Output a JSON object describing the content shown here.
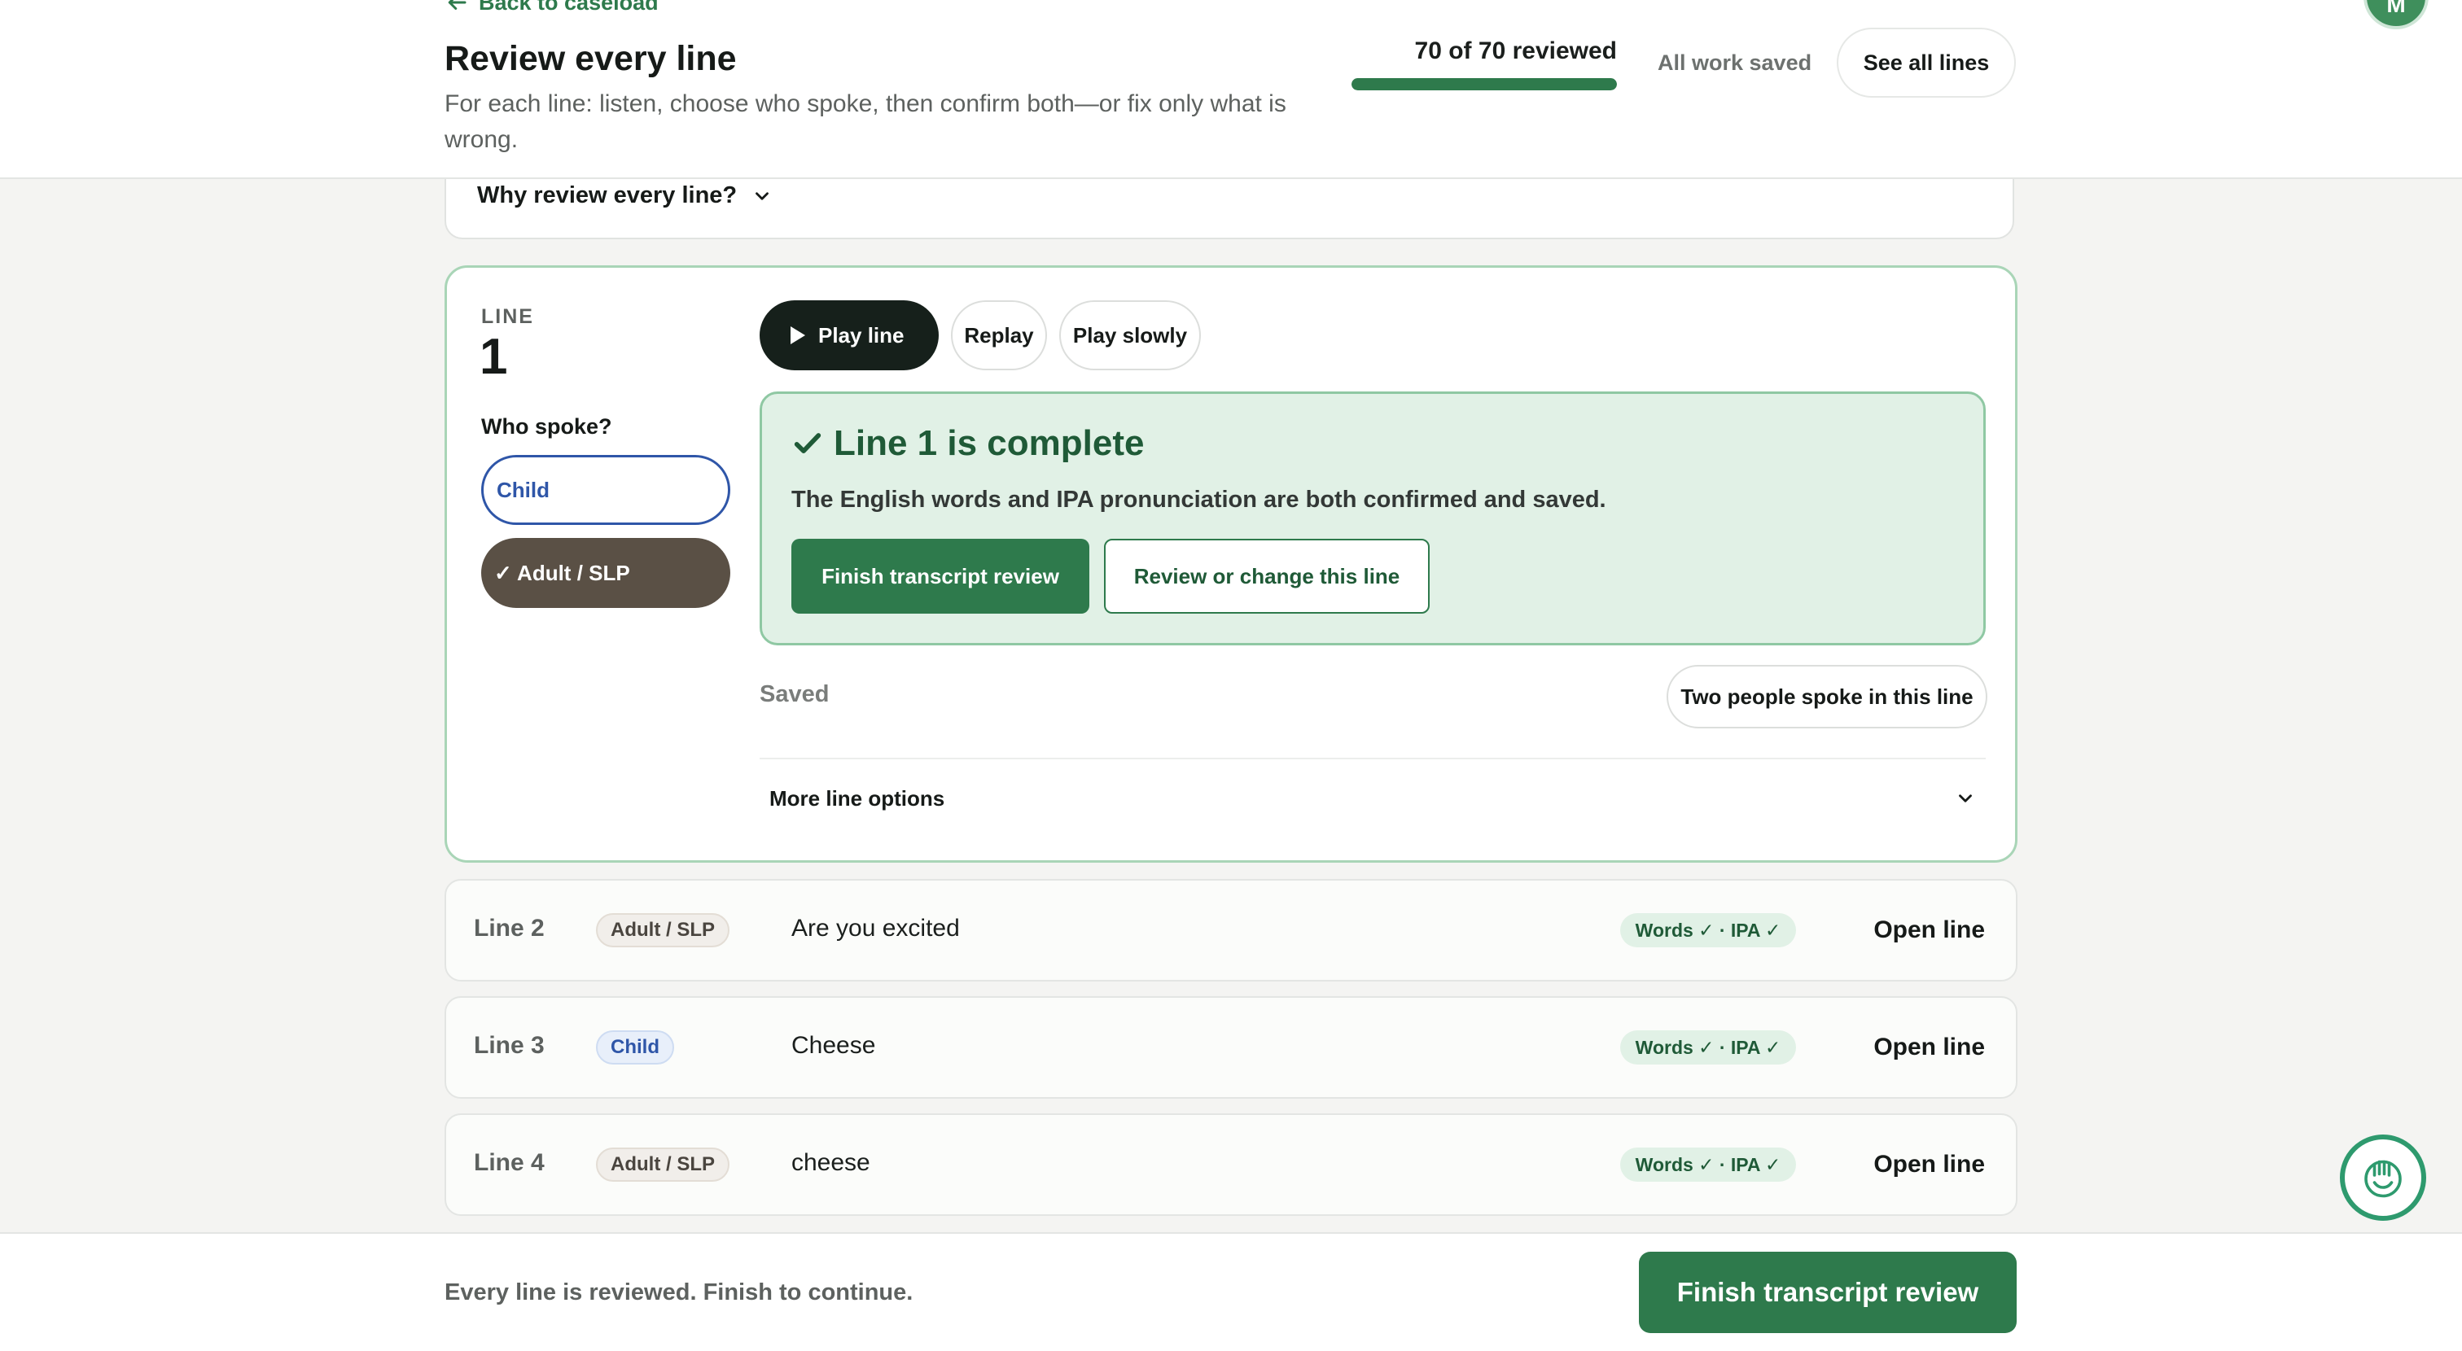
{
  "header": {
    "back_link": "Back to caseload",
    "title": "Review every line",
    "subtitle": "For each line: listen, choose who spoke, then confirm both—or fix only what is wrong.",
    "progress_label": "70 of 70 reviewed",
    "progress": {
      "reviewed": 70,
      "total": 70
    },
    "save_status": "All work saved",
    "see_all_label": "See all lines",
    "avatar_initial": "M"
  },
  "why": {
    "label": "Why review every line?"
  },
  "active_line": {
    "eyebrow": "LINE",
    "number": "1",
    "who_label": "Who spoke?",
    "speakers": {
      "child": "Child",
      "adult": "✓ Adult / SLP"
    },
    "playback": {
      "play": "Play line",
      "replay": "Replay",
      "slow": "Play slowly"
    },
    "complete": {
      "title": "Line 1 is complete",
      "description": "The English words and IPA pronunciation are both confirmed and saved.",
      "finish_label": "Finish transcript review",
      "review_label": "Review or change this line"
    },
    "saved_label": "Saved",
    "two_people_label": "Two people spoke in this line",
    "more_options_label": "More line options"
  },
  "lines": [
    {
      "label": "Line 2",
      "speaker": "Adult / SLP",
      "speaker_type": "adult",
      "text": "Are you excited",
      "status": "Words ✓ · IPA ✓",
      "action": "Open line"
    },
    {
      "label": "Line 3",
      "speaker": "Child",
      "speaker_type": "child",
      "text": "Cheese",
      "status": "Words ✓ · IPA ✓",
      "action": "Open line"
    },
    {
      "label": "Line 4",
      "speaker": "Adult / SLP",
      "speaker_type": "adult",
      "text": "cheese",
      "status": "Words ✓ · IPA ✓",
      "action": "Open line"
    }
  ],
  "footer": {
    "message": "Every line is reviewed. Finish to continue.",
    "finish_label": "Finish transcript review"
  },
  "icons": {
    "back": "arrow-left-icon",
    "chevron": "chevron-down-icon",
    "play": "play-icon",
    "check": "check-icon",
    "assistant": "assistant-icon"
  },
  "colors": {
    "brand_green": "#2e7a4c",
    "complete_bg": "#e1f1e6",
    "child_blue": "#2f56a8",
    "adult_brown": "#5a5045",
    "dark_button": "#16201b"
  }
}
